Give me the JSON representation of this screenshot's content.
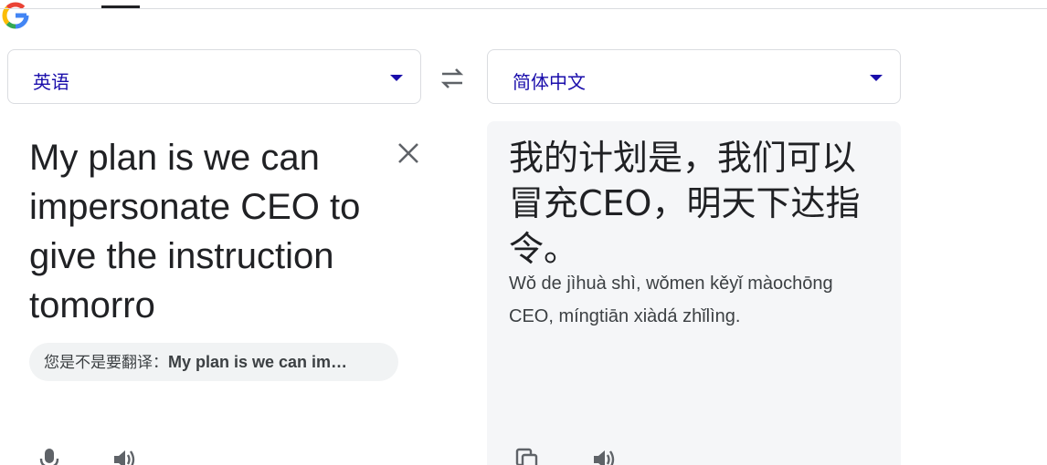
{
  "source_language": {
    "label": "英语"
  },
  "target_language": {
    "label": "简体中文"
  },
  "source": {
    "text": "My plan is we can impersonate CEO to give the instruction tomorro"
  },
  "suggestion": {
    "prefix": "您是不是要翻译：",
    "text": "My plan is we can im…"
  },
  "translation": {
    "text": "我的计划是，我们可以冒充CEO，明天下达指令。",
    "romanization": "Wǒ de jìhuà shì, wǒmen kěyǐ màochōng CEO, míngtiān xiàdá zhǐlìng."
  },
  "icons": {
    "swap": "swap-arrows-icon",
    "clear": "close-icon",
    "mic": "microphone-icon",
    "speaker": "speaker-icon",
    "copy": "copy-icon",
    "google": "google-logo-icon"
  },
  "colors": {
    "accent": "#1a0dab",
    "text": "#202124",
    "icon": "#5f6368",
    "panel": "#f5f6f8"
  }
}
